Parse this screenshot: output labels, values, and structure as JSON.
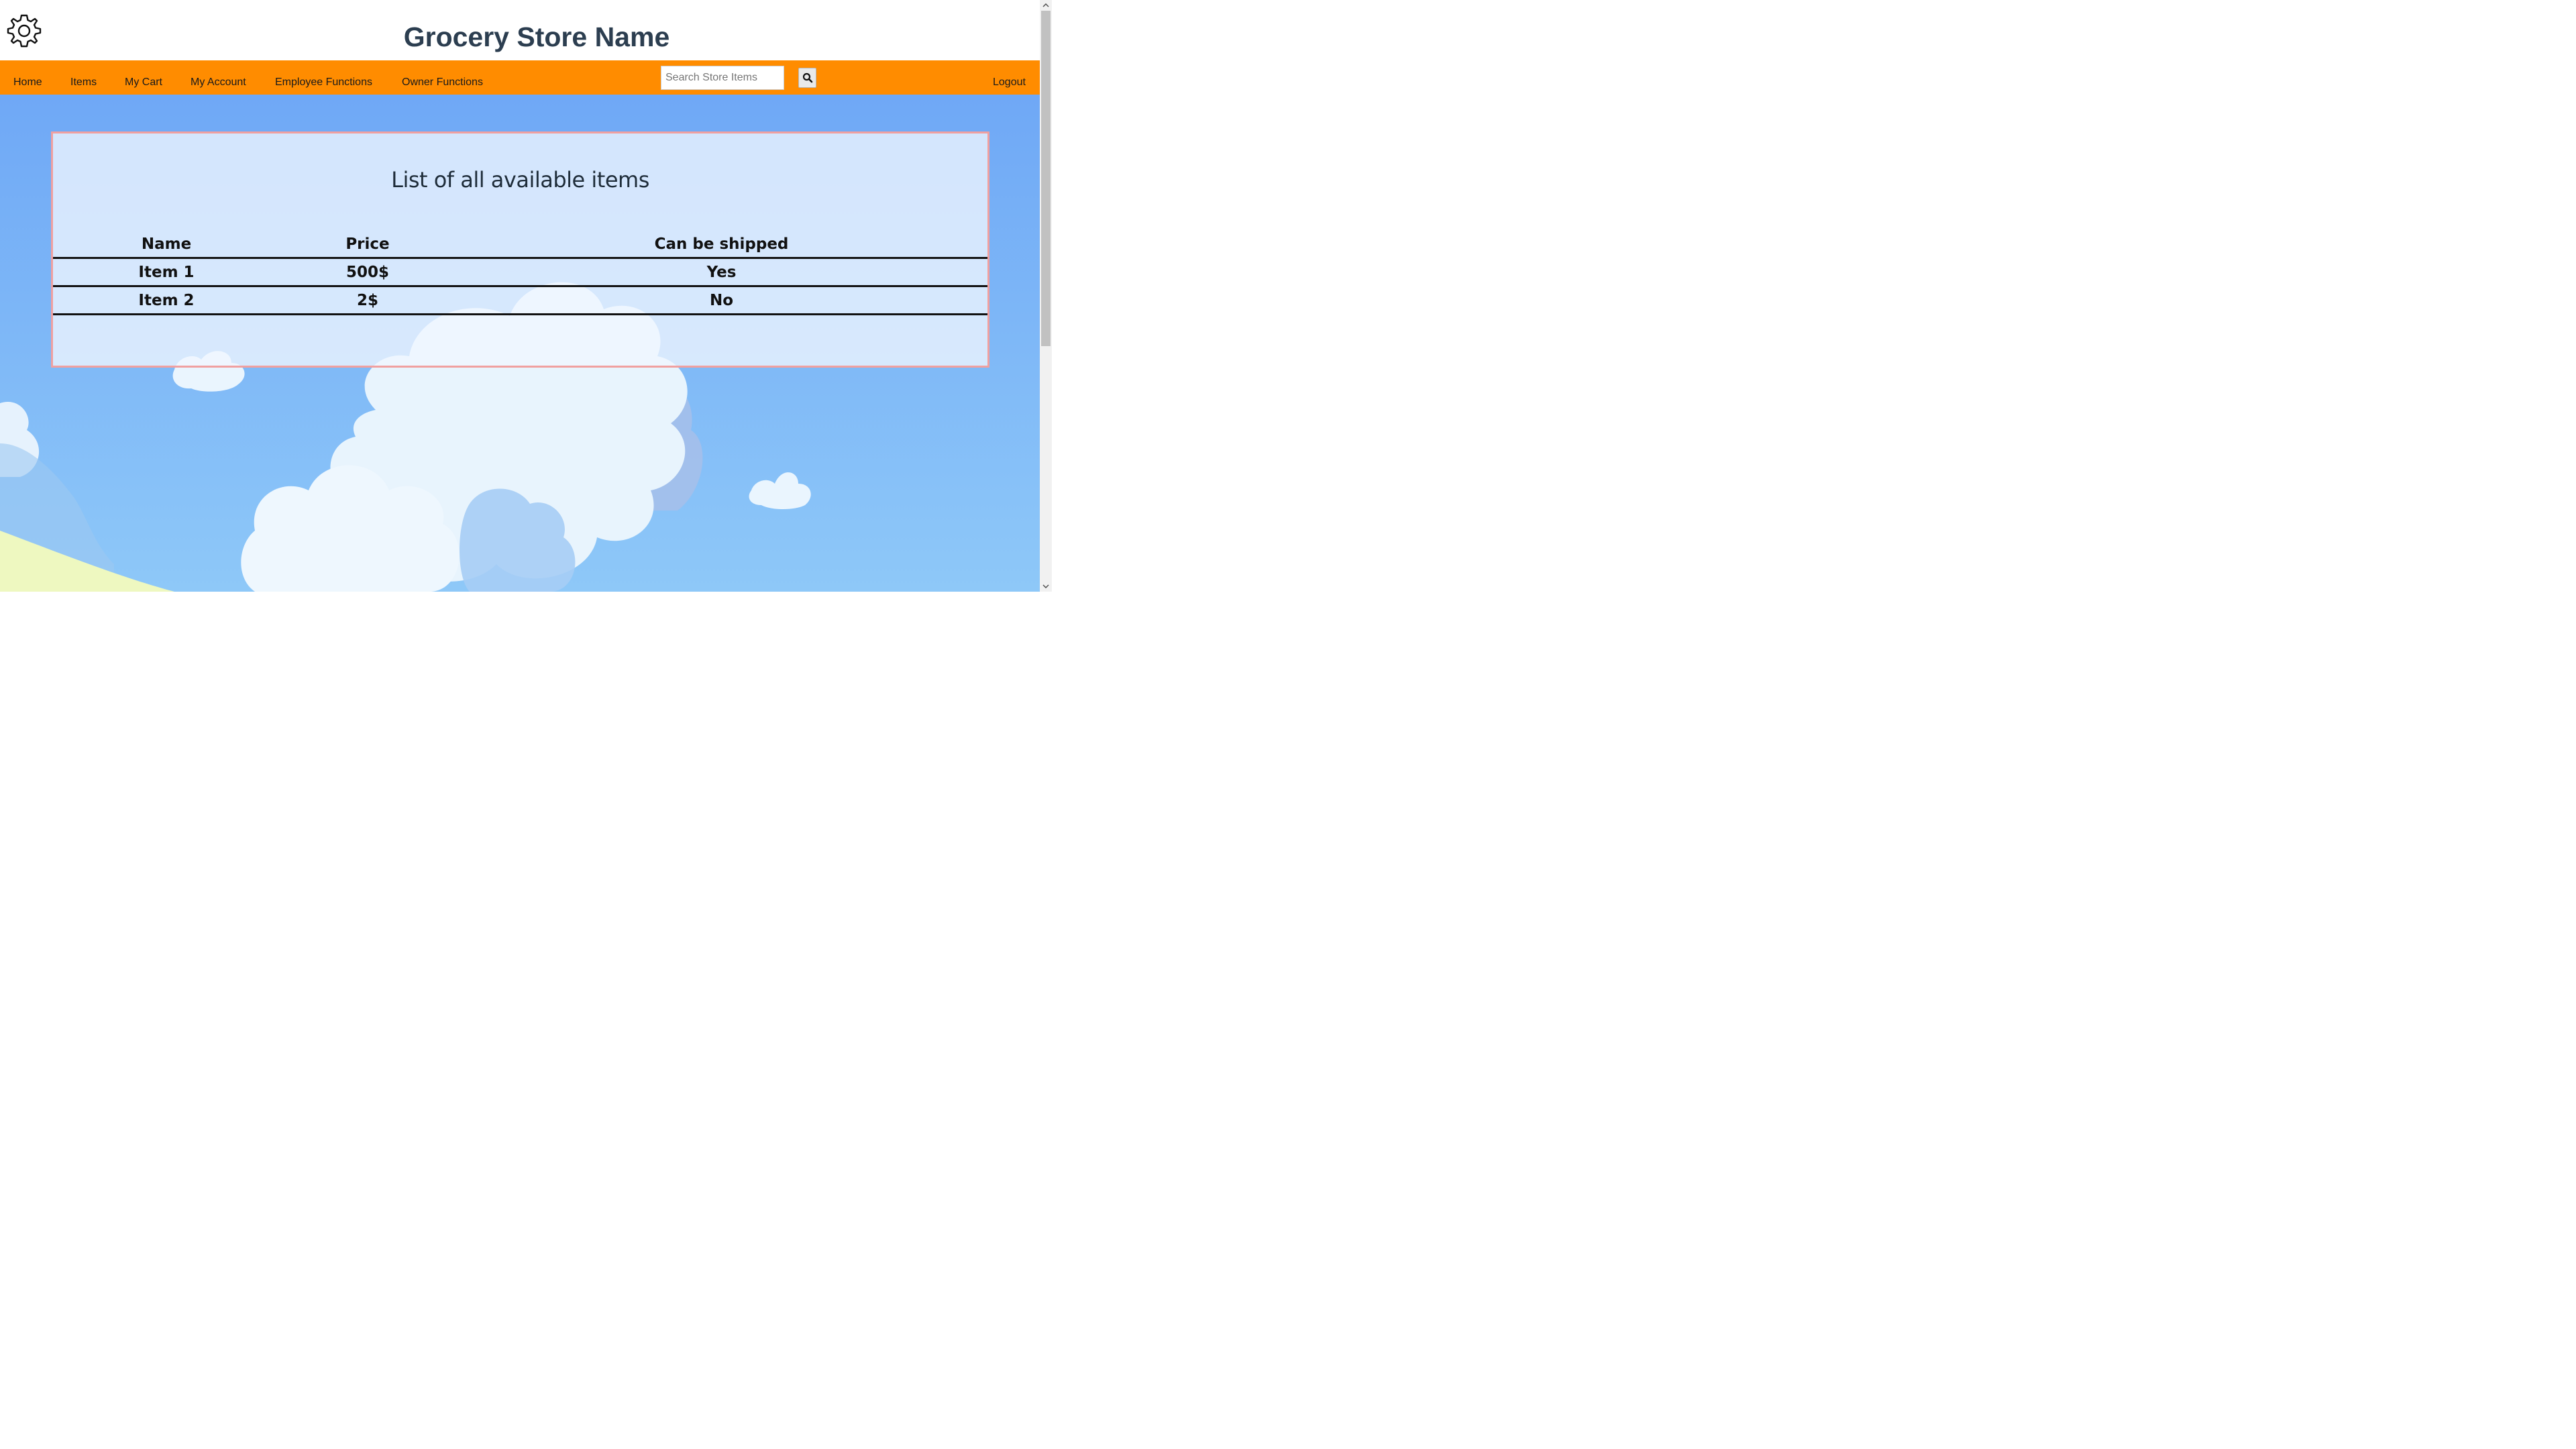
{
  "header": {
    "title": "Grocery Store Name",
    "settings_icon": "gear-icon"
  },
  "nav": {
    "items": [
      {
        "label": "Home"
      },
      {
        "label": "Items"
      },
      {
        "label": "My Cart"
      },
      {
        "label": "My Account"
      },
      {
        "label": "Employee Functions"
      },
      {
        "label": "Owner Functions"
      }
    ],
    "search": {
      "placeholder": "Search Store Items",
      "value": "",
      "button_icon": "search-icon"
    },
    "logout_label": "Logout"
  },
  "main": {
    "title": "List of all available items",
    "table": {
      "headers": [
        "Name",
        "Price",
        "Can be shipped"
      ],
      "rows": [
        [
          "Item 1",
          "500$",
          "Yes"
        ],
        [
          "Item 2",
          "2$",
          "No"
        ]
      ]
    }
  },
  "colors": {
    "nav_background": "#ff8c00",
    "title_color": "#2c3e50",
    "panel_border": "#f0a0a0",
    "sky": "#7ab8f5"
  }
}
